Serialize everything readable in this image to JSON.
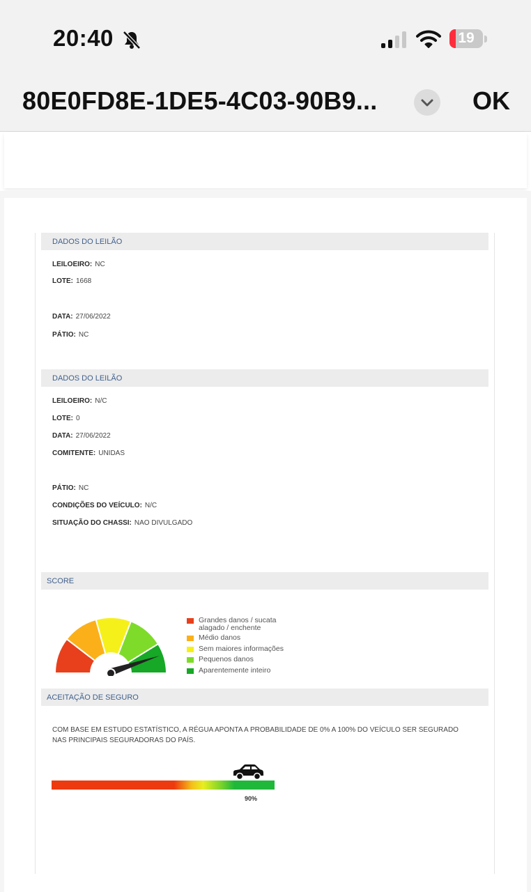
{
  "status_bar": {
    "time": "20:40",
    "battery": "19"
  },
  "nav": {
    "title": "80E0FD8E-1DE5-4C03-90B9...",
    "done_label": "OK"
  },
  "section1": {
    "title": "DADOS DO LEILÃO",
    "rows": [
      {
        "label": "LEILOEIRO:",
        "value": "NC"
      },
      {
        "label": "LOTE:",
        "value": "1668"
      },
      {
        "label": "DATA:",
        "value": "27/06/2022"
      },
      {
        "label": "PÁTIO:",
        "value": "NC"
      }
    ]
  },
  "section2": {
    "title": "DADOS DO LEILÃO",
    "rows": [
      {
        "label": "LEILOEIRO:",
        "value": "N/C"
      },
      {
        "label": "LOTE:",
        "value": "0"
      },
      {
        "label": "DATA:",
        "value": "27/06/2022"
      },
      {
        "label": "COMITENTE:",
        "value": "UNIDAS"
      },
      {
        "label": "PÁTIO:",
        "value": "NC"
      },
      {
        "label": "CONDIÇÕES DO VEÍCULO:",
        "value": "N/C"
      },
      {
        "label": "SITUAÇÃO DO CHASSI:",
        "value": "NAO DIVULGADO"
      }
    ]
  },
  "score": {
    "title": "SCORE",
    "gauge_value": "Aparentemente inteiro",
    "legend": [
      {
        "line1": "Grandes danos / sucata",
        "line2": "alagado / enchente",
        "color": "#e8401c"
      },
      {
        "line1": "Médio danos",
        "line2": "",
        "color": "#fbb01a"
      },
      {
        "line1": "Sem maiores informações",
        "line2": "",
        "color": "#f6f01a"
      },
      {
        "line1": "Pequenos danos",
        "line2": "",
        "color": "#7fdb2a"
      },
      {
        "line1": "Aparentemente inteiro",
        "line2": "",
        "color": "#16a826"
      }
    ]
  },
  "insurance": {
    "title": "ACEITAÇÃO DE SEGURO",
    "text": "COM BASE EM ESTUDO ESTATÍSTICO, A RÉGUA APONTA A PROBABILIDADE DE 0% A 100% DO VEÍCULO SER SEGURADO NAS PRINCIPAIS SEGURADORAS DO PAÍS.",
    "probability": 0.9,
    "probability_label": "90%"
  }
}
